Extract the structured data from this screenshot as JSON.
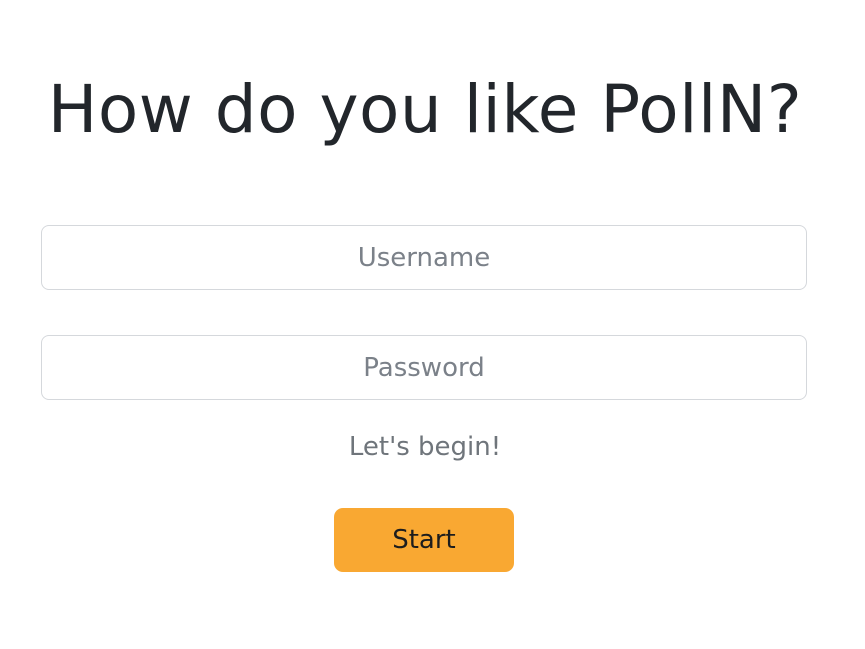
{
  "heading": {
    "title": "How do you like PollN?"
  },
  "form": {
    "username": {
      "value": "",
      "placeholder": "Username"
    },
    "password": {
      "value": "",
      "placeholder": "Password"
    },
    "prompt": "Let's begin!",
    "start_label": "Start"
  },
  "colors": {
    "accent": "#f9a832",
    "title_text": "#22262b",
    "muted_text": "#6f757b",
    "border": "#d5d8dc",
    "background": "#ffffff"
  }
}
